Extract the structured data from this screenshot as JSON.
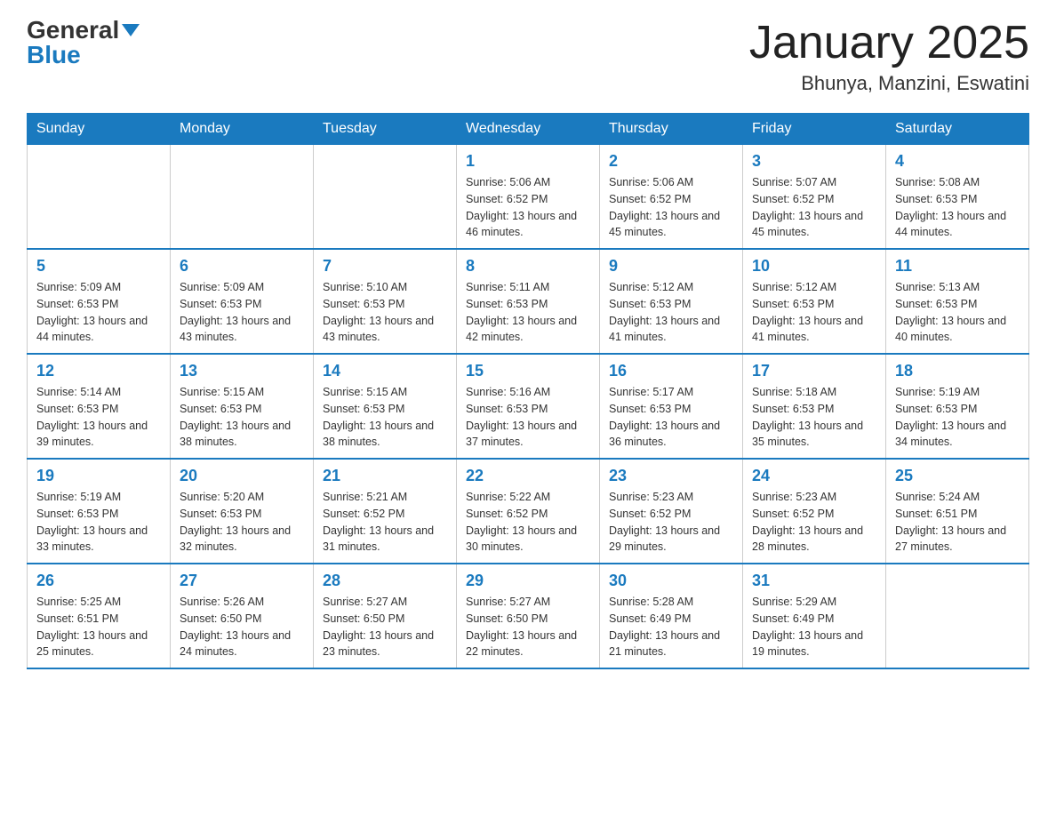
{
  "header": {
    "logo_general": "General",
    "logo_blue": "Blue",
    "title": "January 2025",
    "subtitle": "Bhunya, Manzini, Eswatini"
  },
  "days_of_week": [
    "Sunday",
    "Monday",
    "Tuesday",
    "Wednesday",
    "Thursday",
    "Friday",
    "Saturday"
  ],
  "weeks": [
    [
      {
        "day": "",
        "info": ""
      },
      {
        "day": "",
        "info": ""
      },
      {
        "day": "",
        "info": ""
      },
      {
        "day": "1",
        "info": "Sunrise: 5:06 AM\nSunset: 6:52 PM\nDaylight: 13 hours and 46 minutes."
      },
      {
        "day": "2",
        "info": "Sunrise: 5:06 AM\nSunset: 6:52 PM\nDaylight: 13 hours and 45 minutes."
      },
      {
        "day": "3",
        "info": "Sunrise: 5:07 AM\nSunset: 6:52 PM\nDaylight: 13 hours and 45 minutes."
      },
      {
        "day": "4",
        "info": "Sunrise: 5:08 AM\nSunset: 6:53 PM\nDaylight: 13 hours and 44 minutes."
      }
    ],
    [
      {
        "day": "5",
        "info": "Sunrise: 5:09 AM\nSunset: 6:53 PM\nDaylight: 13 hours and 44 minutes."
      },
      {
        "day": "6",
        "info": "Sunrise: 5:09 AM\nSunset: 6:53 PM\nDaylight: 13 hours and 43 minutes."
      },
      {
        "day": "7",
        "info": "Sunrise: 5:10 AM\nSunset: 6:53 PM\nDaylight: 13 hours and 43 minutes."
      },
      {
        "day": "8",
        "info": "Sunrise: 5:11 AM\nSunset: 6:53 PM\nDaylight: 13 hours and 42 minutes."
      },
      {
        "day": "9",
        "info": "Sunrise: 5:12 AM\nSunset: 6:53 PM\nDaylight: 13 hours and 41 minutes."
      },
      {
        "day": "10",
        "info": "Sunrise: 5:12 AM\nSunset: 6:53 PM\nDaylight: 13 hours and 41 minutes."
      },
      {
        "day": "11",
        "info": "Sunrise: 5:13 AM\nSunset: 6:53 PM\nDaylight: 13 hours and 40 minutes."
      }
    ],
    [
      {
        "day": "12",
        "info": "Sunrise: 5:14 AM\nSunset: 6:53 PM\nDaylight: 13 hours and 39 minutes."
      },
      {
        "day": "13",
        "info": "Sunrise: 5:15 AM\nSunset: 6:53 PM\nDaylight: 13 hours and 38 minutes."
      },
      {
        "day": "14",
        "info": "Sunrise: 5:15 AM\nSunset: 6:53 PM\nDaylight: 13 hours and 38 minutes."
      },
      {
        "day": "15",
        "info": "Sunrise: 5:16 AM\nSunset: 6:53 PM\nDaylight: 13 hours and 37 minutes."
      },
      {
        "day": "16",
        "info": "Sunrise: 5:17 AM\nSunset: 6:53 PM\nDaylight: 13 hours and 36 minutes."
      },
      {
        "day": "17",
        "info": "Sunrise: 5:18 AM\nSunset: 6:53 PM\nDaylight: 13 hours and 35 minutes."
      },
      {
        "day": "18",
        "info": "Sunrise: 5:19 AM\nSunset: 6:53 PM\nDaylight: 13 hours and 34 minutes."
      }
    ],
    [
      {
        "day": "19",
        "info": "Sunrise: 5:19 AM\nSunset: 6:53 PM\nDaylight: 13 hours and 33 minutes."
      },
      {
        "day": "20",
        "info": "Sunrise: 5:20 AM\nSunset: 6:53 PM\nDaylight: 13 hours and 32 minutes."
      },
      {
        "day": "21",
        "info": "Sunrise: 5:21 AM\nSunset: 6:52 PM\nDaylight: 13 hours and 31 minutes."
      },
      {
        "day": "22",
        "info": "Sunrise: 5:22 AM\nSunset: 6:52 PM\nDaylight: 13 hours and 30 minutes."
      },
      {
        "day": "23",
        "info": "Sunrise: 5:23 AM\nSunset: 6:52 PM\nDaylight: 13 hours and 29 minutes."
      },
      {
        "day": "24",
        "info": "Sunrise: 5:23 AM\nSunset: 6:52 PM\nDaylight: 13 hours and 28 minutes."
      },
      {
        "day": "25",
        "info": "Sunrise: 5:24 AM\nSunset: 6:51 PM\nDaylight: 13 hours and 27 minutes."
      }
    ],
    [
      {
        "day": "26",
        "info": "Sunrise: 5:25 AM\nSunset: 6:51 PM\nDaylight: 13 hours and 25 minutes."
      },
      {
        "day": "27",
        "info": "Sunrise: 5:26 AM\nSunset: 6:50 PM\nDaylight: 13 hours and 24 minutes."
      },
      {
        "day": "28",
        "info": "Sunrise: 5:27 AM\nSunset: 6:50 PM\nDaylight: 13 hours and 23 minutes."
      },
      {
        "day": "29",
        "info": "Sunrise: 5:27 AM\nSunset: 6:50 PM\nDaylight: 13 hours and 22 minutes."
      },
      {
        "day": "30",
        "info": "Sunrise: 5:28 AM\nSunset: 6:49 PM\nDaylight: 13 hours and 21 minutes."
      },
      {
        "day": "31",
        "info": "Sunrise: 5:29 AM\nSunset: 6:49 PM\nDaylight: 13 hours and 19 minutes."
      },
      {
        "day": "",
        "info": ""
      }
    ]
  ]
}
